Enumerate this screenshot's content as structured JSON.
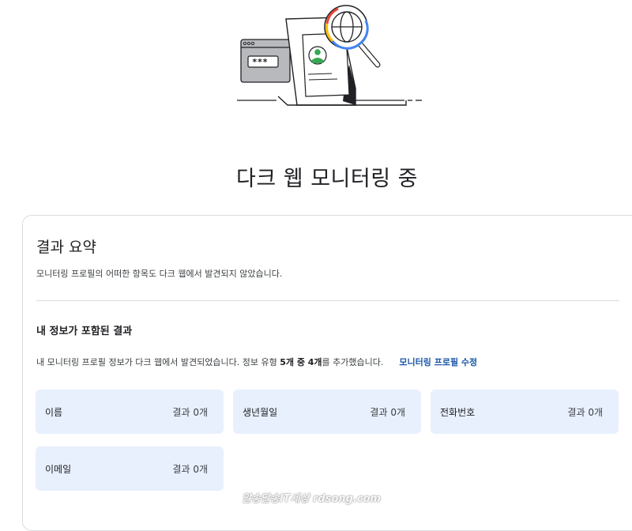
{
  "page": {
    "title": "다크 웹 모니터링 중"
  },
  "summary": {
    "title": "결과 요약",
    "description": "모니터링 프로필의 어떠한 항목도 다크 웹에서 발견되지 않았습니다."
  },
  "my_info": {
    "title": "내 정보가 포함된 결과",
    "desc_before": "내 모니터링 프로필 정보가 다크 웹에서 발견되었습니다. 정보 유형 ",
    "desc_bold": "5개 중 4개",
    "desc_after": "를 추가했습니다.",
    "edit_link": "모니터링 프로필 수정"
  },
  "tiles": [
    {
      "label": "이름",
      "result": "결과 0개"
    },
    {
      "label": "생년월일",
      "result": "결과 0개"
    },
    {
      "label": "전화번호",
      "result": "결과 0개"
    },
    {
      "label": "이메일",
      "result": "결과 0개"
    }
  ],
  "illustration": {
    "password_mask": "***"
  },
  "watermark": {
    "text": "알송달송IT세상 rdsong.com"
  },
  "colors": {
    "tile_background": "#e8f0fe",
    "link": "#1a56a8",
    "border": "#dadce0",
    "google_blue": "#4285f4",
    "google_red": "#ea4335",
    "google_yellow": "#fbbc04",
    "google_green": "#34a853"
  }
}
